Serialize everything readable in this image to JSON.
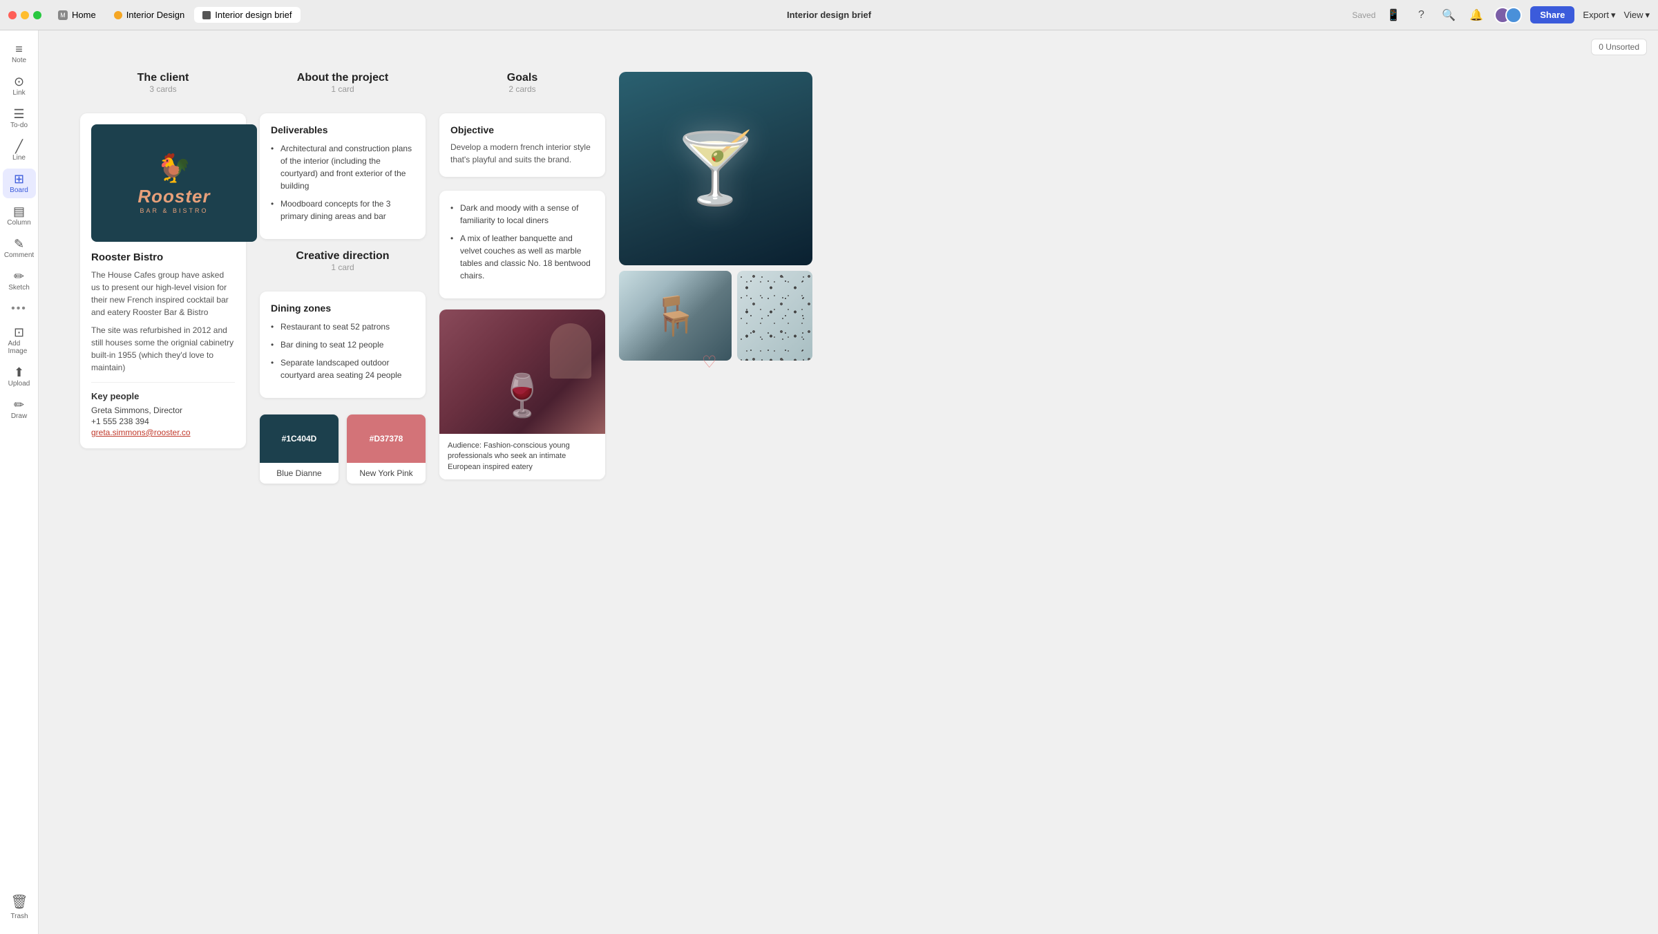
{
  "titlebar": {
    "title": "Interior design brief",
    "saved_label": "Saved",
    "tabs": [
      {
        "label": "Home",
        "type": "home",
        "active": false
      },
      {
        "label": "Interior Design",
        "type": "workspace",
        "active": false
      },
      {
        "label": "Interior design brief",
        "type": "doc",
        "active": true
      }
    ],
    "share_label": "Share",
    "export_label": "Export",
    "view_label": "View",
    "unsorted_label": "0 Unsorted"
  },
  "sidebar": {
    "items": [
      {
        "label": "Note",
        "icon": "≡",
        "active": false
      },
      {
        "label": "Link",
        "icon": "⊙",
        "active": false
      },
      {
        "label": "To-do",
        "icon": "☰",
        "active": false
      },
      {
        "label": "Line",
        "icon": "╱",
        "active": false
      },
      {
        "label": "Board",
        "icon": "⊞",
        "active": true
      },
      {
        "label": "Column",
        "icon": "▤",
        "active": false
      },
      {
        "label": "Comment",
        "icon": "✎",
        "active": false
      },
      {
        "label": "Sketch",
        "icon": "✏",
        "active": false
      },
      {
        "label": "Add Image",
        "icon": "⊡",
        "active": false
      },
      {
        "label": "Upload",
        "icon": "⬆",
        "active": false
      },
      {
        "label": "Draw",
        "icon": "✏",
        "active": false
      }
    ],
    "trash_label": "Trash"
  },
  "columns": {
    "client": {
      "title": "The client",
      "count": "3 cards",
      "logo_alt": "Rooster Bar & Bistro Logo",
      "company_name": "Rooster Bistro",
      "description_1": "The House Cafes group have asked us to present our high-level vision for their new French inspired cocktail bar and eatery Rooster Bar & Bistro",
      "description_2": "The site was refurbished in 2012 and still houses some the orignial cabinetry built-in 1955 (which they'd love to maintain)",
      "key_people_title": "Key people",
      "contact_name": "Greta Simmons, Director",
      "contact_phone": "+1 555 238 394",
      "contact_email": "greta.simmons@rooster.co"
    },
    "about": {
      "title": "About the project",
      "count": "1 card",
      "deliverables_title": "Deliverables",
      "deliverables_items": [
        "Architectural and construction plans of the interior (including the courtyard) and front exterior of the building",
        "Moodboard concepts for the 3 primary dining areas and bar"
      ],
      "creative_title": "Creative direction",
      "creative_count": "1 card",
      "dining_title": "Dining zones",
      "dining_items": [
        "Restaurant to seat 52 patrons",
        "Bar dining to seat 12 people",
        "Separate landscaped outdoor courtyard area seating 24 people"
      ],
      "color1_hex": "#1C404D",
      "color1_label": "Blue Dianne",
      "color2_hex": "#D37378",
      "color2_label": "New York Pink"
    },
    "goals": {
      "title": "Goals",
      "count": "2 cards",
      "objective_title": "Objective",
      "objective_desc": "Develop a modern french interior style that's playful and suits the brand.",
      "goals_items": [
        "Dark and moody with a sense of familiarity to local diners",
        "A mix of leather banquette and velvet couches as well as marble tables and classic No. 18 bentwood chairs."
      ],
      "audience_caption": "Audience: Fashion-conscious young professionals who seek an intimate European inspired eatery"
    }
  }
}
